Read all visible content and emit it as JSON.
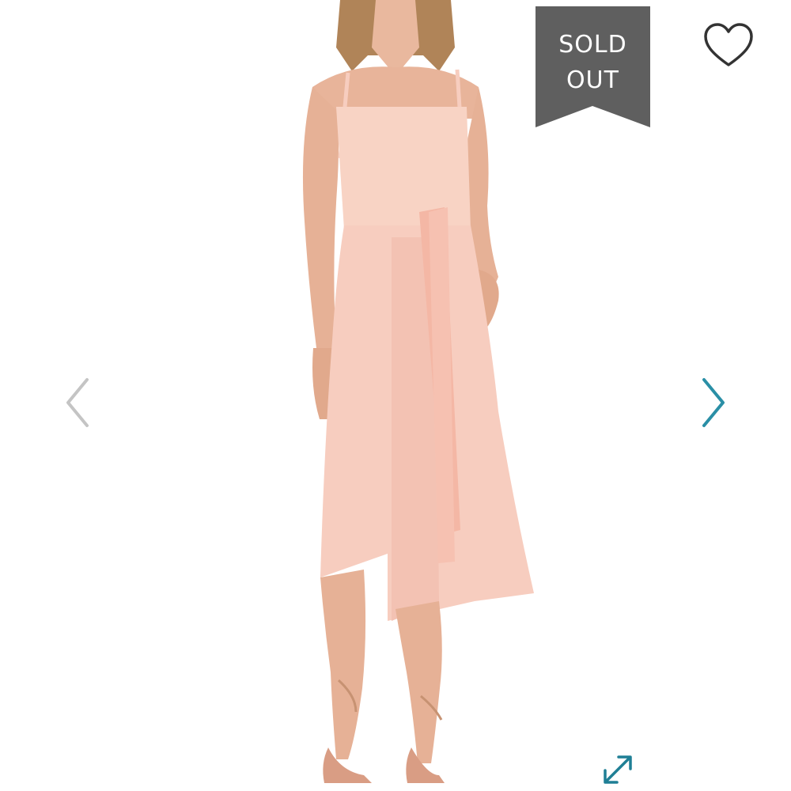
{
  "badge": {
    "line1": "SOLD",
    "line2": "OUT",
    "color": "#5f5f5f"
  },
  "icons": {
    "wishlist": "heart-outline-icon",
    "previous": "chevron-left-icon",
    "next": "chevron-right-icon",
    "expand": "expand-arrows-icon"
  },
  "colors": {
    "arrow_prev": "#c4c4c4",
    "arrow_next": "#2a8fa6",
    "expand": "#1f7f95",
    "dress": "#f7cdbf",
    "skin": "#e8b49a",
    "hair": "#b08458"
  }
}
